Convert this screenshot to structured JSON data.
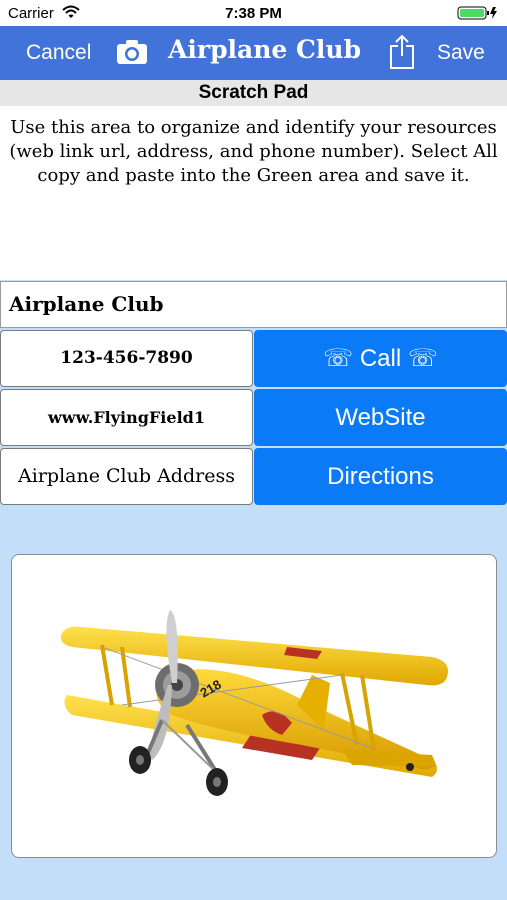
{
  "status_bar": {
    "carrier": "Carrier",
    "time": "7:38 PM"
  },
  "nav": {
    "cancel": "Cancel",
    "title": "Airplane Club",
    "save": "Save"
  },
  "scratch_pad": {
    "header": "Scratch Pad",
    "text": "Use this area to organize and identify your resources (web link url, address, and phone number). Select All copy and paste into the Green area and save it."
  },
  "club_name": "Airplane Club",
  "fields": {
    "phone": "123-456-7890",
    "website": "www.FlyingField1",
    "address": "Airplane Club Address"
  },
  "buttons": {
    "call": "☏ Call ☏",
    "website": "WebSite",
    "directions": "Directions"
  },
  "aircraft_tail_number": "218",
  "colors": {
    "nav_blue": "#4273d8",
    "button_blue": "#0b7af6",
    "background": "#c3def9",
    "plane_yellow": "#f5c518",
    "plane_red": "#c0392b"
  }
}
